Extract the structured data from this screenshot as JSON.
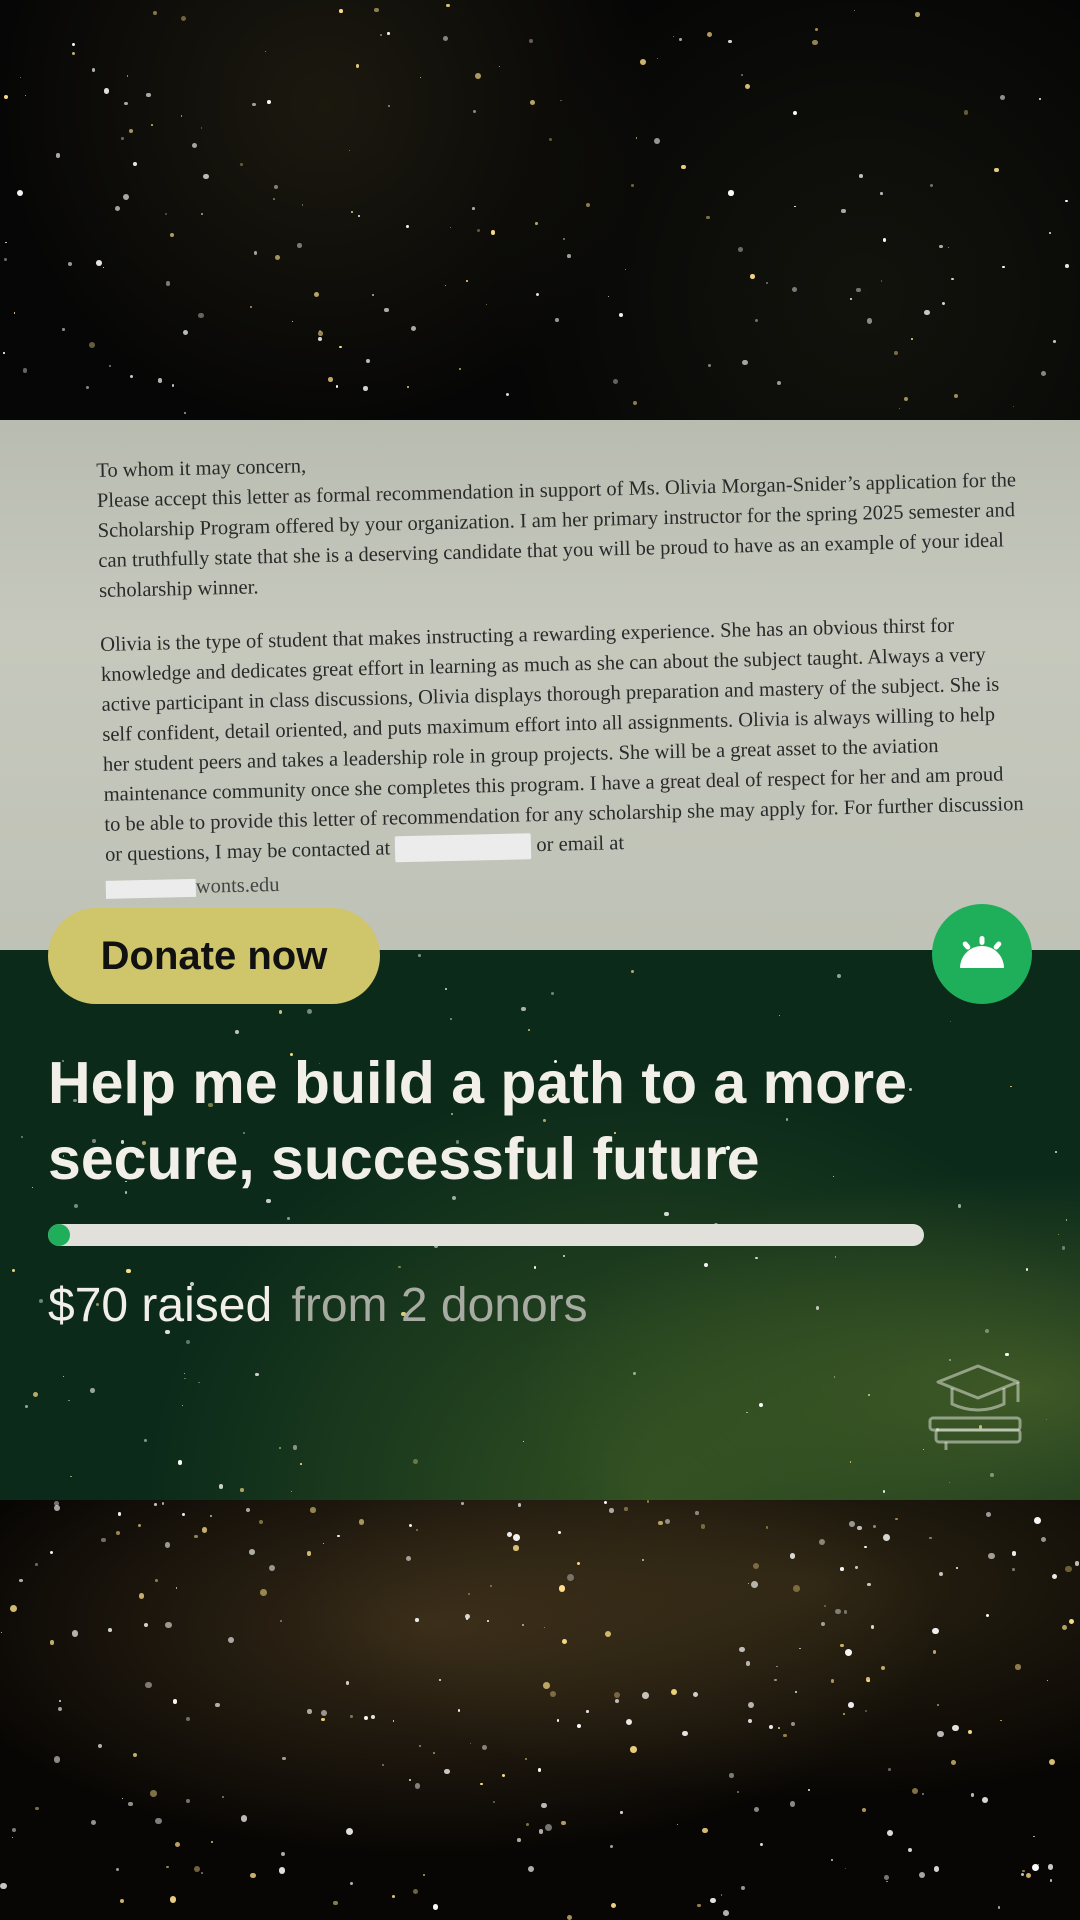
{
  "letter": {
    "greeting": "To whom it may concern,",
    "paragraph1": "Please accept this letter as formal recommendation in support of Ms. Olivia Morgan-Snider’s application for the Scholarship Program offered by your organization. I am her primary instructor for the spring 2025 semester and can truthfully state that she is a deserving candidate that you will be proud to have as an example of your ideal scholarship winner.",
    "paragraph2": "Olivia is the type of student that makes instructing a rewarding experience. She has an obvious thirst for knowledge and dedicates great effort in learning as much as she can about the subject taught. Always a very active participant in class discussions, Olivia displays thorough preparation and mastery of the subject. She is self confident, detail oriented, and puts maximum effort into all assignments. Olivia is always willing to help her student peers and takes a leadership role in group projects. She will be a great asset to the aviation maintenance community once she completes this program. I have a great deal of respect for her and am proud to be able to provide this letter of recommendation for any scholarship she may apply for. For further discussion or questions, I may be contacted at",
    "contact_tail": "or email at",
    "email_tail": "wonts.edu"
  },
  "actions": {
    "donate_label": "Donate now"
  },
  "fundraiser": {
    "title": "Help me build a path to a more secure, successful future",
    "amount_raised": "$70 raised",
    "donors_text": "from 2 donors",
    "progress_fraction": 0.025
  },
  "colors": {
    "accent_green": "#1fae5a",
    "donate_button": "#cfc56a",
    "panel_background": "#0b2a1a"
  },
  "icons": {
    "logo": "gofundme-logo-icon",
    "decoration": "graduation-cap-books-icon"
  }
}
